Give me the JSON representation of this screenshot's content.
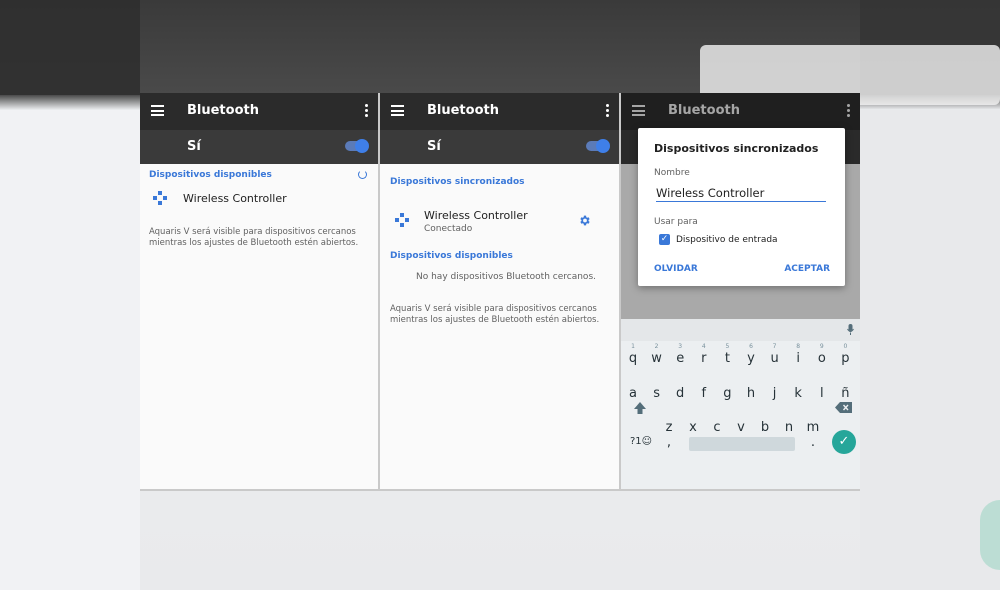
{
  "colors": {
    "accent": "#3a78d8",
    "appbar": "#2b2b2b",
    "switchbar": "#3a3a3a",
    "enter_key": "#26a69a"
  },
  "panel1": {
    "title": "Bluetooth",
    "switch_label": "Sí",
    "section_available": "Dispositivos disponibles",
    "device_name": "Wireless Controller",
    "hint": "Aquaris V será visible para dispositivos cercanos mientras los ajustes de Bluetooth estén abiertos."
  },
  "panel2": {
    "title": "Bluetooth",
    "switch_label": "Sí",
    "section_paired": "Dispositivos sincronizados",
    "device_name": "Wireless Controller",
    "device_status": "Conectado",
    "section_available": "Dispositivos disponibles",
    "no_devices": "No hay dispositivos Bluetooth cercanos.",
    "hint": "Aquaris V será visible para dispositivos cercanos mientras los ajustes de Bluetooth estén abiertos."
  },
  "panel3": {
    "title": "Bluetooth",
    "dialog": {
      "title": "Dispositivos sincronizados",
      "name_label": "Nombre",
      "name_value": "Wireless Controller",
      "use_for_label": "Usar para",
      "checkbox_label": "Dispositivo de entrada",
      "forget_button": "OLVIDAR",
      "accept_button": "ACEPTAR"
    },
    "keyboard": {
      "row1": [
        "q",
        "w",
        "e",
        "r",
        "t",
        "y",
        "u",
        "i",
        "o",
        "p"
      ],
      "row1_nums": [
        "1",
        "2",
        "3",
        "4",
        "5",
        "6",
        "7",
        "8",
        "9",
        "0"
      ],
      "row2": [
        "a",
        "s",
        "d",
        "f",
        "g",
        "h",
        "j",
        "k",
        "l",
        "ñ"
      ],
      "row3": [
        "z",
        "x",
        "c",
        "v",
        "b",
        "n",
        "m"
      ],
      "symbols_key": "?1☺",
      "comma_key": ",",
      "period_key": "."
    }
  }
}
